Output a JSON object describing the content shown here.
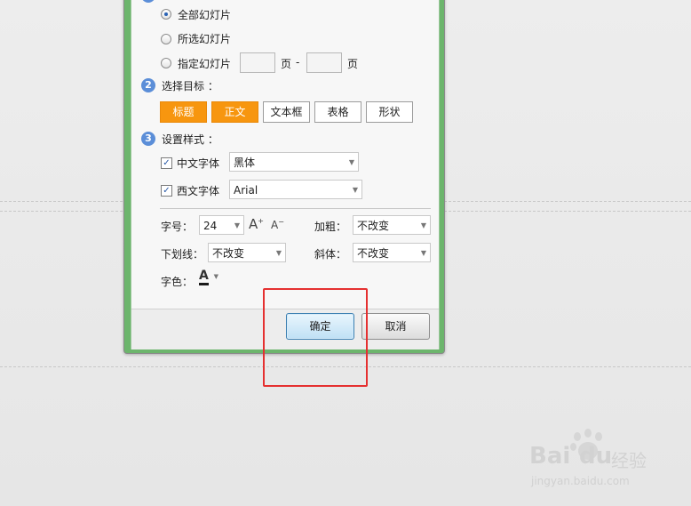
{
  "range": {
    "options": [
      {
        "label": "全部幻灯片",
        "selected": true
      },
      {
        "label": "所选幻灯片",
        "selected": false
      },
      {
        "label": "指定幻灯片",
        "selected": false
      }
    ],
    "page_unit_1": "页",
    "page_separator": "-",
    "page_unit_2": "页"
  },
  "target": {
    "step": "2",
    "heading": "选择目标 ：",
    "buttons": [
      {
        "label": "标题",
        "active": true
      },
      {
        "label": "正文",
        "active": true
      },
      {
        "label": "文本框",
        "active": false
      },
      {
        "label": "表格",
        "active": false
      },
      {
        "label": "形状",
        "active": false
      }
    ]
  },
  "style": {
    "step": "3",
    "heading": "设置样式 ：",
    "cn_font": {
      "label": "中文字体",
      "checked": true,
      "value": "黑体"
    },
    "west_font": {
      "label": "西文字体",
      "checked": true,
      "value": "Arial"
    },
    "size_label": "字号：",
    "size_value": "24",
    "grow_icon_text": "A",
    "grow_icon_sup": "+",
    "shrink_icon_text": "A",
    "shrink_icon_sup": "−",
    "bold_label": "加粗：",
    "bold_value": "不改变",
    "underline_label": "下划线：",
    "underline_value": "不改变",
    "italic_label": "斜体：",
    "italic_value": "不改变",
    "color_label": "字色：",
    "color_icon_text": "A",
    "font_color": "#1a1a1a"
  },
  "footer": {
    "ok_label": "确定",
    "cancel_label": "取消"
  },
  "watermark": {
    "brand_left": "Bai",
    "brand_right": "du",
    "suffix": "经验",
    "url": "jingyan.baidu.com"
  },
  "colors": {
    "accent_orange": "#f7960f",
    "dialog_frame_green": "#6cb56c",
    "step_badge_blue": "#5b8ed8",
    "highlight_red": "#e53030"
  }
}
